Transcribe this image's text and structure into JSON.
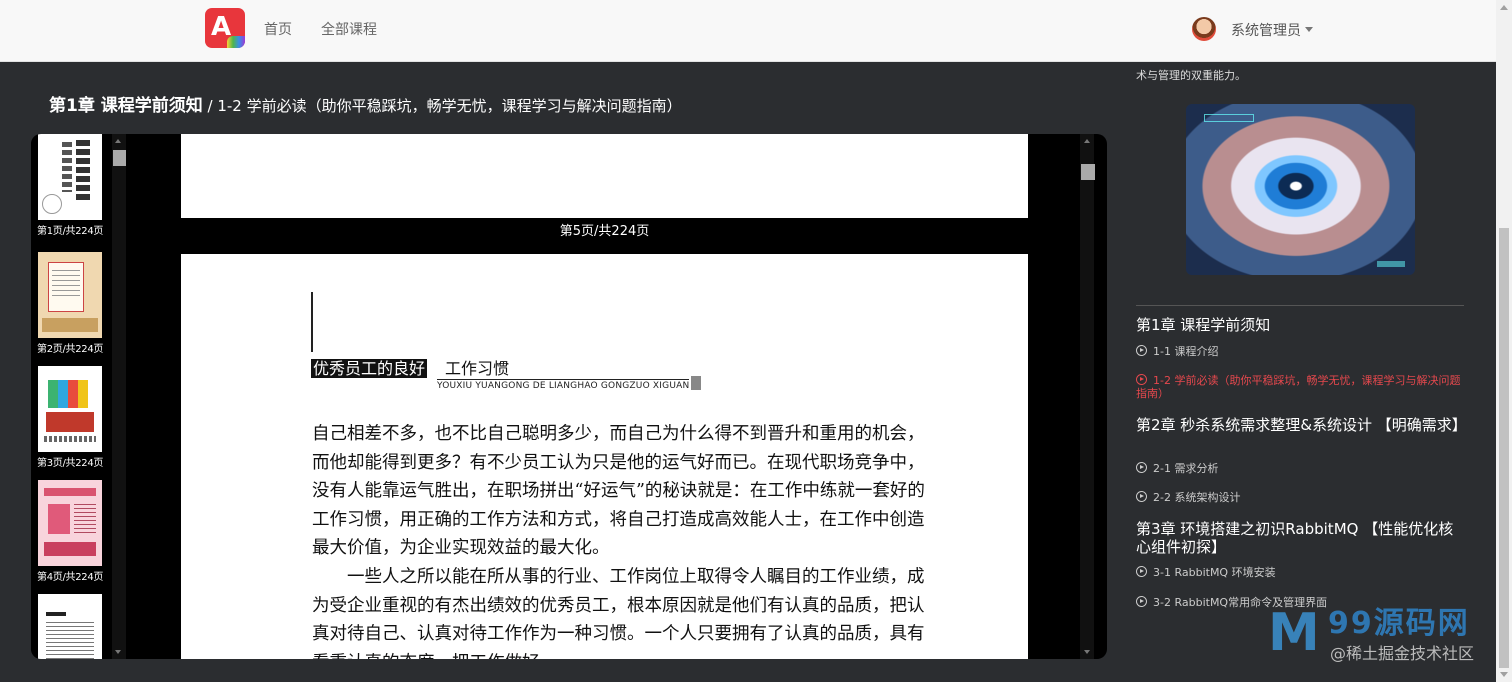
{
  "nav": {
    "home": "首页",
    "all_courses": "全部课程",
    "user_name": "系统管理员"
  },
  "lesson": {
    "chapter_title": "第1章 课程学前须知",
    "subtitle": " / 1-2 学前必读（助你平稳踩坑，畅学无忧，课程学习与解决问题指南）"
  },
  "viewer": {
    "thumbnails": [
      {
        "label": "第1页/共224页"
      },
      {
        "label": "第2页/共224页"
      },
      {
        "label": "第3页/共224页"
      },
      {
        "label": "第4页/共224页"
      }
    ],
    "current_page_label": "第5页/共224页",
    "page": {
      "heading_highlight": "优秀员工的良好",
      "heading_rest": "工作习惯",
      "heading_pinyin": "YOUXIU YUANGONG DE LIANGHAO GONGZUO XIGUAN",
      "paragraphs": [
        "自己相差不多，也不比自己聪明多少，而自己为什么得不到晋升和重用的机会，而他却能得到更多？有不少员工认为只是他的运气好而已。在现代职场竞争中，没有人能靠运气胜出，在职场拼出“好运气”的秘诀就是：在工作中练就一套好的工作习惯，用正确的工作方法和方式，将自己打造成高效能人士，在工作中创造最大价值，为企业实现效益的最大化。",
        "一些人之所以能在所从事的行业、工作岗位上取得令人瞩目的工作业绩，成为受企业重视的有杰出绩效的优秀员工，根本原因就是他们有认真的品质，把认真对待自己、认真对待工作作为一种习惯。一个人只要拥有了认真的品质，具有看重认真的态度，把工作做好"
      ]
    }
  },
  "sidebar": {
    "intro_fragment": "术与管理的双重能力。",
    "chapters": [
      {
        "title": "第1章 课程学前须知",
        "lessons": [
          {
            "label": "1-1 课程介绍",
            "active": false
          },
          {
            "label": "1-2 学前必读（助你平稳踩坑，畅学无忧，课程学习与解决问题指南）",
            "active": true
          }
        ]
      },
      {
        "title": "第2章 秒杀系统需求整理&系统设计 【明确需求】",
        "lessons": [
          {
            "label": "2-1 需求分析",
            "active": false
          },
          {
            "label": "2-2 系统架构设计",
            "active": false
          }
        ]
      },
      {
        "title": "第3章 环境搭建之初识RabbitMQ 【性能优化核心组件初探】",
        "lessons": [
          {
            "label": "3-1 RabbitMQ 环境安装",
            "active": false
          },
          {
            "label": "3-2 RabbitMQ常用命令及管理界面",
            "active": false
          }
        ]
      }
    ]
  },
  "watermark": {
    "logo_text": "99源码网",
    "sub_text": "@稀土掘金技术社区"
  },
  "colors": {
    "active_lesson": "#e5484d",
    "background": "#2b2d30",
    "nav_bg": "#f8f8f8"
  }
}
